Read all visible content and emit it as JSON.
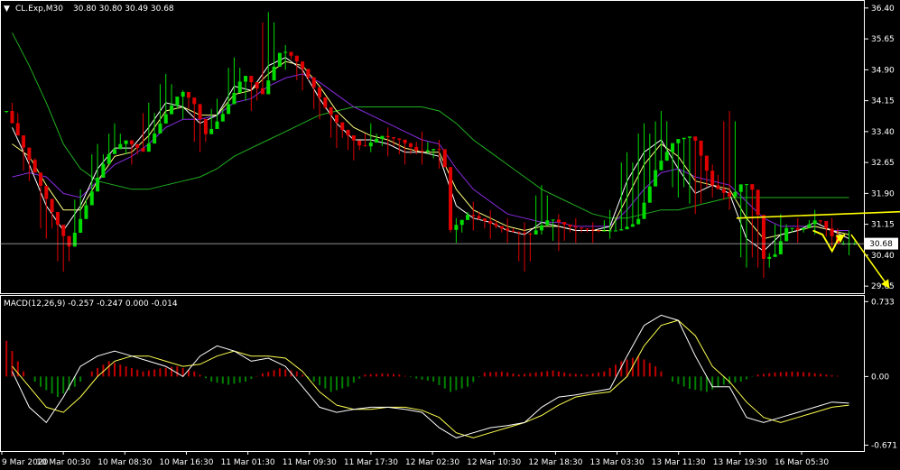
{
  "header": {
    "arrow_glyph": "▼",
    "symbol": "CL.Exp,M30",
    "ohlc": "30.80 30.80 30.49 30.68"
  },
  "macd_header": "MACD(12,26,9) -0.257 -0.247 0.000 -0.014",
  "colors": {
    "background": "#000000",
    "bull": "#00dc00",
    "bear": "#e00000",
    "ma_fast": "#ffffff",
    "ma_mid": "#ffff80",
    "ma_slow": "#8a2be2",
    "ma_long": "#20b020",
    "annotation": "#ffff00",
    "hist_pos": "#c00000",
    "hist_neg": "#008000",
    "macd_line": "#ffffff",
    "signal_line": "#ffff50",
    "axis": "#ffffff"
  },
  "chart_data": [
    {
      "type": "candlestick",
      "title": "CL.Exp,M30",
      "last_price": "30.68",
      "ylim": [
        29.5,
        36.55
      ],
      "yticks": [
        "36.40",
        "35.65",
        "34.90",
        "34.15",
        "33.40",
        "32.65",
        "31.90",
        "31.15",
        "30.40",
        "29.65"
      ],
      "xticks": [
        "9 Mar 2020",
        "10 Mar 00:30",
        "10 Mar 08:30",
        "10 Mar 16:30",
        "11 Mar 01:30",
        "11 Mar 09:30",
        "11 Mar 17:30",
        "12 Mar 02:30",
        "12 Mar 10:30",
        "12 Mar 18:30",
        "13 Mar 03:30",
        "13 Mar 11:30",
        "13 Mar 19:30",
        "16 Mar 05:30"
      ],
      "close_path": [
        [
          0,
          33.9
        ],
        [
          4,
          32.6
        ],
        [
          8,
          31.2
        ],
        [
          10,
          30.6
        ],
        [
          13,
          31.7
        ],
        [
          16,
          32.8
        ],
        [
          19,
          33.2
        ],
        [
          22,
          32.9
        ],
        [
          25,
          33.7
        ],
        [
          28,
          34.4
        ],
        [
          30,
          34.1
        ],
        [
          32,
          33.3
        ],
        [
          35,
          33.9
        ],
        [
          38,
          34.8
        ],
        [
          41,
          34.3
        ],
        [
          44,
          35.4
        ],
        [
          46,
          35.2
        ],
        [
          48,
          34.8
        ],
        [
          51,
          34.0
        ],
        [
          54,
          33.4
        ],
        [
          57,
          33.0
        ],
        [
          60,
          33.3
        ],
        [
          63,
          33.2
        ],
        [
          66,
          32.9
        ],
        [
          69,
          33.0
        ],
        [
          70,
          32.9
        ],
        [
          71,
          31.0
        ],
        [
          74,
          31.4
        ],
        [
          77,
          31.2
        ],
        [
          80,
          31.0
        ],
        [
          84,
          30.9
        ],
        [
          87,
          31.3
        ],
        [
          90,
          31.1
        ],
        [
          94,
          31.0
        ],
        [
          98,
          31.0
        ],
        [
          101,
          31.2
        ],
        [
          104,
          32.5
        ],
        [
          107,
          33.2
        ],
        [
          110,
          33.3
        ],
        [
          113,
          32.1
        ],
        [
          116,
          31.8
        ],
        [
          118,
          32.2
        ],
        [
          120,
          31.9
        ],
        [
          121,
          30.3
        ],
        [
          123,
          30.4
        ],
        [
          125,
          31.1
        ],
        [
          127,
          31.0
        ],
        [
          130,
          31.3
        ],
        [
          132,
          30.9
        ],
        [
          133,
          30.68
        ]
      ],
      "candle_highs": [
        34.1,
        33.0,
        31.7,
        30.9,
        32.0,
        33.1,
        33.6,
        33.2,
        34.1,
        34.8,
        34.4,
        33.6,
        34.2,
        35.2,
        34.6,
        36.3,
        35.5,
        35.0,
        34.3,
        33.7,
        33.3,
        33.6,
        33.5,
        33.2,
        33.4,
        33.2,
        31.3,
        31.7,
        31.5,
        31.3,
        31.2,
        32.1,
        31.4,
        31.3,
        31.2,
        31.5,
        32.9,
        33.6,
        33.9,
        32.5,
        32.1,
        32.6,
        33.9,
        31.6,
        30.7,
        31.4,
        31.3,
        31.5,
        31.3,
        31.0
      ],
      "candle_lows": [
        33.6,
        32.2,
        30.8,
        30.0,
        31.4,
        32.5,
        32.9,
        32.6,
        33.4,
        34.0,
        33.7,
        32.9,
        33.5,
        34.4,
        33.9,
        34.9,
        34.9,
        34.4,
        33.7,
        33.0,
        32.7,
        32.9,
        32.8,
        32.6,
        32.6,
        32.5,
        30.7,
        31.0,
        30.8,
        30.7,
        30.0,
        30.9,
        30.5,
        30.7,
        30.7,
        30.8,
        31.9,
        32.9,
        32.9,
        31.8,
        31.4,
        31.8,
        31.5,
        30.1,
        29.85,
        30.7,
        30.7,
        30.9,
        30.6,
        30.4
      ],
      "ma_fast": [
        33.5,
        32.6,
        31.6,
        31.0,
        31.6,
        32.5,
        33.0,
        33.0,
        33.5,
        34.1,
        34.0,
        33.6,
        33.8,
        34.5,
        34.4,
        35.0,
        35.2,
        34.9,
        34.2,
        33.6,
        33.2,
        33.2,
        33.1,
        32.9,
        32.9,
        32.8,
        31.6,
        31.3,
        31.2,
        31.0,
        30.9,
        31.2,
        31.1,
        31.0,
        31.0,
        31.1,
        32.2,
        32.9,
        33.2,
        32.5,
        31.9,
        32.1,
        31.9,
        30.8,
        30.5,
        30.9,
        31.0,
        31.2,
        31.0,
        30.8
      ],
      "ma_mid": [
        33.1,
        32.8,
        32.1,
        31.5,
        31.5,
        32.2,
        32.8,
        32.9,
        33.3,
        33.9,
        34.0,
        33.8,
        33.8,
        34.3,
        34.4,
        34.8,
        35.1,
        35.0,
        34.5,
        33.9,
        33.5,
        33.3,
        33.2,
        33.0,
        32.9,
        32.9,
        32.0,
        31.5,
        31.3,
        31.1,
        31.0,
        31.1,
        31.1,
        31.0,
        31.0,
        31.0,
        31.8,
        32.6,
        33.1,
        32.8,
        32.2,
        32.1,
        32.0,
        31.3,
        30.8,
        30.9,
        31.0,
        31.1,
        31.0,
        30.9
      ],
      "ma_slow": [
        32.3,
        32.4,
        32.3,
        31.9,
        31.8,
        32.2,
        32.6,
        32.8,
        33.1,
        33.5,
        33.7,
        33.7,
        33.8,
        34.1,
        34.2,
        34.5,
        34.7,
        34.8,
        34.6,
        34.3,
        34.0,
        33.8,
        33.6,
        33.4,
        33.2,
        33.1,
        32.5,
        32.0,
        31.7,
        31.4,
        31.3,
        31.2,
        31.2,
        31.1,
        31.1,
        31.1,
        31.5,
        32.0,
        32.4,
        32.5,
        32.3,
        32.2,
        32.1,
        31.7,
        31.3,
        31.1,
        31.1,
        31.1,
        31.0,
        31.0
      ],
      "ma_long": [
        35.8,
        35.0,
        34.1,
        33.1,
        32.5,
        32.2,
        32.1,
        32.0,
        32.0,
        32.1,
        32.2,
        32.3,
        32.5,
        32.8,
        33.0,
        33.2,
        33.4,
        33.6,
        33.8,
        33.9,
        34.0,
        34.0,
        34.0,
        34.0,
        34.0,
        33.9,
        33.6,
        33.2,
        32.9,
        32.6,
        32.3,
        32.0,
        31.8,
        31.6,
        31.4,
        31.3,
        31.3,
        31.4,
        31.5,
        31.5,
        31.6,
        31.7,
        31.8,
        31.8,
        31.8,
        31.8,
        31.8,
        31.8,
        31.8,
        31.8
      ],
      "annotations": [
        {
          "kind": "line-arrow",
          "from": [
            115,
            31.3
          ],
          "to": [
            148,
            31.5
          ]
        },
        {
          "kind": "path-arrow",
          "points": [
            [
              127,
              31.0
            ],
            [
              128.5,
              30.9
            ],
            [
              130,
              30.5
            ],
            [
              131,
              30.8
            ],
            [
              132,
              30.9
            ]
          ]
        },
        {
          "kind": "line-arrow",
          "from": [
            133,
            30.9
          ],
          "to": [
            139,
            29.6
          ]
        }
      ]
    },
    {
      "type": "bar+line",
      "title": "MACD(12,26,9)",
      "ylim": [
        -0.72,
        0.78
      ],
      "yticks": [
        "0.733",
        "0.00",
        "-0.671"
      ],
      "histogram": [
        0.35,
        0.05,
        -0.1,
        -0.2,
        -0.1,
        0.05,
        0.15,
        0.1,
        0.05,
        0.08,
        0.1,
        0.05,
        -0.05,
        -0.08,
        -0.05,
        0.03,
        0.08,
        0.05,
        -0.05,
        -0.15,
        -0.1,
        0.02,
        0.03,
        0.02,
        -0.02,
        -0.05,
        -0.15,
        -0.1,
        0.04,
        0.05,
        0.02,
        0.04,
        0.06,
        0.03,
        0.02,
        0.05,
        0.15,
        0.2,
        0.1,
        -0.05,
        -0.12,
        -0.15,
        -0.08,
        -0.05,
        0.02,
        0.04,
        0.05,
        0.04,
        0.02,
        0.0
      ],
      "macd": [
        0.05,
        -0.3,
        -0.45,
        -0.2,
        0.1,
        0.2,
        0.25,
        0.2,
        0.15,
        0.1,
        0.0,
        0.2,
        0.3,
        0.25,
        0.15,
        0.18,
        0.1,
        -0.1,
        -0.3,
        -0.35,
        -0.32,
        -0.3,
        -0.3,
        -0.32,
        -0.35,
        -0.5,
        -0.6,
        -0.55,
        -0.5,
        -0.48,
        -0.45,
        -0.3,
        -0.2,
        -0.18,
        -0.15,
        -0.12,
        0.2,
        0.5,
        0.6,
        0.55,
        0.2,
        -0.1,
        -0.1,
        -0.4,
        -0.45,
        -0.4,
        -0.35,
        -0.3,
        -0.25,
        -0.26
      ],
      "signal": [
        0.1,
        -0.1,
        -0.3,
        -0.35,
        -0.2,
        0.0,
        0.15,
        0.2,
        0.2,
        0.15,
        0.1,
        0.12,
        0.2,
        0.25,
        0.2,
        0.2,
        0.18,
        0.05,
        -0.15,
        -0.28,
        -0.32,
        -0.32,
        -0.3,
        -0.3,
        -0.33,
        -0.4,
        -0.55,
        -0.6,
        -0.55,
        -0.5,
        -0.45,
        -0.38,
        -0.28,
        -0.2,
        -0.17,
        -0.15,
        0.0,
        0.3,
        0.5,
        0.55,
        0.4,
        0.1,
        -0.05,
        -0.25,
        -0.4,
        -0.45,
        -0.4,
        -0.35,
        -0.3,
        -0.28
      ]
    }
  ]
}
